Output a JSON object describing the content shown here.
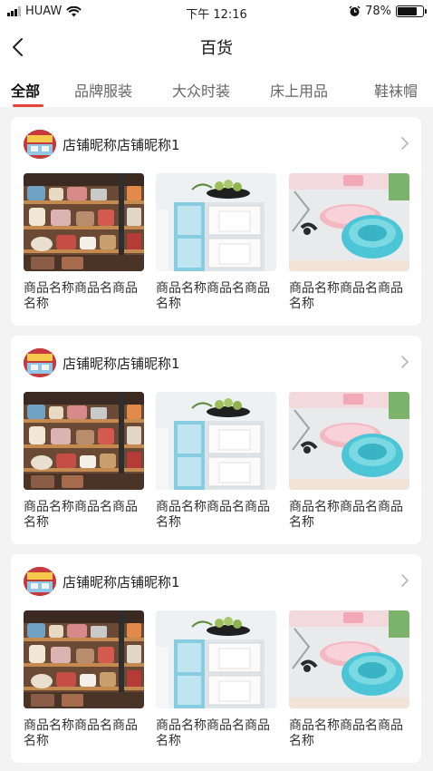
{
  "status": {
    "carrier": "HUAW",
    "time": "下午 12:16",
    "battery": "78%",
    "battery_level": 0.78
  },
  "header": {
    "title": "百货"
  },
  "tabs": [
    {
      "label": "全部"
    },
    {
      "label": "品牌服装"
    },
    {
      "label": "大众时装"
    },
    {
      "label": "床上用品"
    },
    {
      "label": "鞋袜帽"
    }
  ],
  "shops": [
    {
      "name": "店铺昵称店铺昵称1",
      "items": [
        {
          "name": "商品名称商品名商品名称"
        },
        {
          "name": "商品名称商品名商品名称"
        },
        {
          "name": "商品名称商品名商品名称"
        }
      ]
    },
    {
      "name": "店铺昵称店铺昵称1",
      "items": [
        {
          "name": "商品名称商品名商品名称"
        },
        {
          "name": "商品名称商品名商品名称"
        },
        {
          "name": "商品名称商品名商品名称"
        }
      ]
    },
    {
      "name": "店铺昵称店铺昵称1",
      "items": [
        {
          "name": "商品名称商品名商品名称"
        },
        {
          "name": "商品名称商品名商品名称"
        },
        {
          "name": "商品名称商品名商品名称"
        }
      ]
    }
  ],
  "colors": {
    "accent": "#e8433a",
    "background": "#f3f3f3"
  }
}
